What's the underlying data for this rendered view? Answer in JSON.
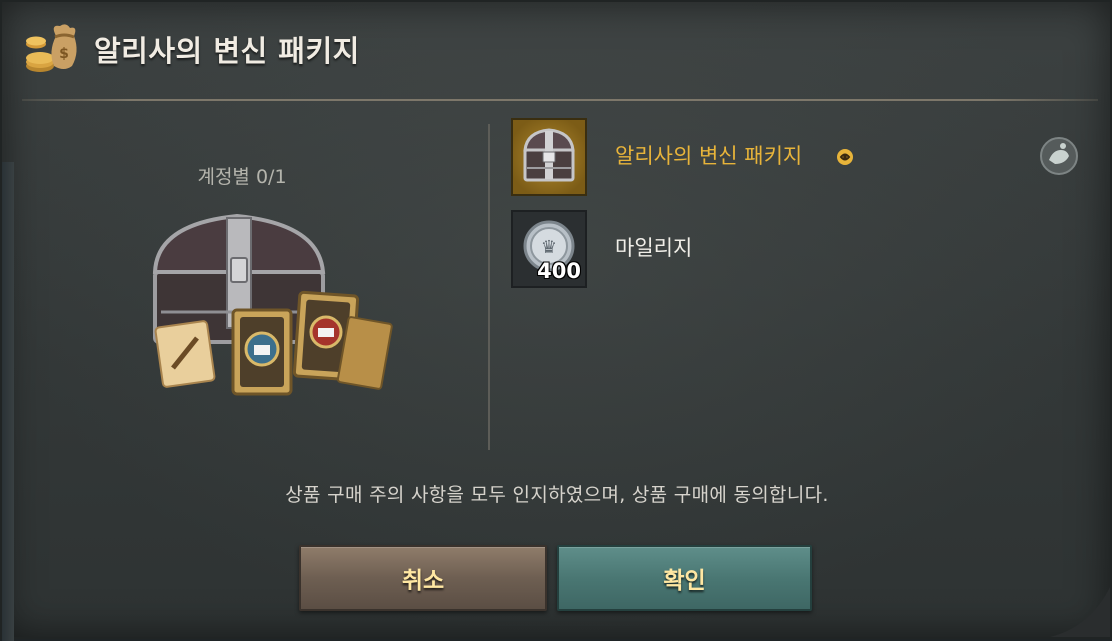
{
  "dialog": {
    "title": "알리사의 변신 패키지",
    "purchase_limit": "계정별 0/1"
  },
  "items": [
    {
      "name": "알리사의 변신 패키지",
      "icon": "treasure-chest-icon",
      "bound_badge": "bound-icon",
      "name_color": "#e8b43a"
    },
    {
      "name": "마일리지",
      "icon": "mileage-coin-icon",
      "count": "400",
      "name_color": "#f0eee8"
    }
  ],
  "consent": {
    "text": "상품 구매 주의 사항을 모두 인지하였으며, 상품 구매에 동의합니다."
  },
  "buttons": {
    "cancel_label": "취소",
    "confirm_label": "확인"
  },
  "colors": {
    "item_name_gold": "#e8b43a",
    "button_text": "#ffe7a2",
    "cancel_button": "#6e5f52",
    "confirm_button": "#4a7773"
  }
}
